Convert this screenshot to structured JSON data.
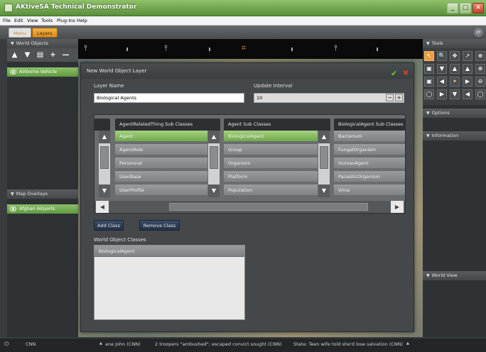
{
  "window": {
    "title": "AKtiveSA Technical Demonstrator",
    "buttons": [
      "_",
      "□",
      "✕"
    ]
  },
  "menu": [
    "File",
    "Edit",
    "View",
    "Tools",
    "Plug-Ins",
    "Help"
  ],
  "tabs": {
    "menu": "Menu",
    "layers": "Layers"
  },
  "left_panel": {
    "world_objects_header": "World Objects",
    "toolbar_icons": [
      "▲",
      "▼",
      "▤",
      "+",
      "—"
    ],
    "world_objects": [
      "Airborne Vehicle"
    ],
    "map_overlays_header": "Map Overlays",
    "map_overlays": [
      "Afghan Airports"
    ]
  },
  "right_panel": {
    "tools_header": "Tools",
    "tool_glyphs": [
      "↖",
      "🔍",
      "✥",
      "↗",
      "⊕",
      "▣",
      "▼",
      "▲",
      "▲",
      "⊕",
      "▣",
      "◀",
      "✦",
      "▶",
      "⊖",
      "◯",
      "▶",
      "▼",
      "◀",
      "◯"
    ],
    "options_header": "Options",
    "information_header": "Information",
    "world_view_header": "World View"
  },
  "dialog": {
    "title": "New World Object Layer",
    "layer_name_label": "Layer Name",
    "layer_name_value": "Biological Agents",
    "update_interval_label": "Update Interval",
    "update_interval_value": "10",
    "minus": "−",
    "plus": "+",
    "columns": [
      {
        "header": "AgentRelatedThing Sub Classes",
        "items": [
          "Agent",
          "AgentRole",
          "Personnel",
          "UserBase",
          "UserProfile"
        ],
        "selected": 0
      },
      {
        "header": "Agent Sub Classes",
        "items": [
          "BiologicalAgent",
          "Group",
          "Organism",
          "Platform",
          "Population"
        ],
        "selected": 0
      },
      {
        "header": "BiologicalAgent Sub Classes",
        "items": [
          "Bacterium",
          "FungalOrganism",
          "HumanAgent",
          "ParasiticOrganism",
          "Virus"
        ],
        "selected": -1
      }
    ],
    "add_class": "Add Class",
    "remove_class": "Remove Class",
    "world_object_classes_label": "World Object Classes",
    "world_object_classes": [
      "BiologicalAgent"
    ]
  },
  "bottom": {
    "channel": "CNN",
    "ticker": [
      "ane John (CNN)",
      "2 troopers \"ambushed\"; escaped convict sought (CNN)",
      "State: Teen wife told she'd lose salvation (CNN)"
    ]
  }
}
